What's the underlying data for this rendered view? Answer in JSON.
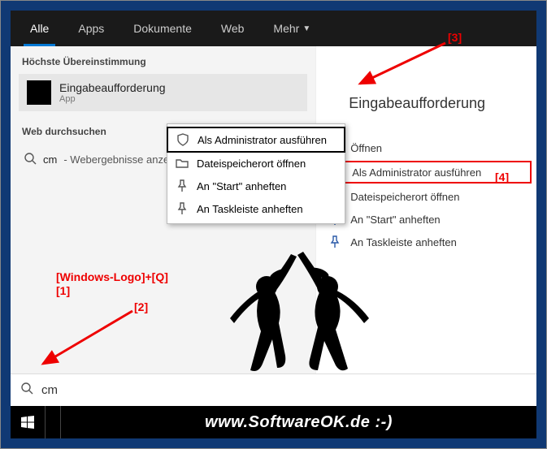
{
  "tabs": {
    "all": "Alle",
    "apps": "Apps",
    "docs": "Dokumente",
    "web": "Web",
    "more": "Mehr"
  },
  "sections": {
    "best": "Höchste Übereinstimmung",
    "websearch": "Web durchsuchen"
  },
  "bestmatch": {
    "title": "Eingabeaufforderung",
    "sub": "App"
  },
  "webline": {
    "term": "cm",
    "suffix": " - Webergebnisse anzeigen"
  },
  "context": {
    "admin": "Als Administrator ausführen",
    "location": "Dateispeicherort öffnen",
    "pinstart": "An \"Start\" anheften",
    "pintask": "An Taskleiste anheften"
  },
  "right": {
    "title": "Eingabeaufforderung",
    "open": "Öffnen",
    "admin": "Als Administrator ausführen",
    "location": "Dateispeicherort öffnen",
    "pinstart": "An \"Start\" anheften",
    "pintask": "An Taskleiste anheften"
  },
  "search": {
    "value": "cm"
  },
  "footer": "www.SoftwareOK.de :-)",
  "annotations": {
    "a1a": "[Windows-Logo]+[Q]",
    "a1b": "[1]",
    "a2": "[2]",
    "a3": "[3]",
    "a4": "[4]"
  }
}
